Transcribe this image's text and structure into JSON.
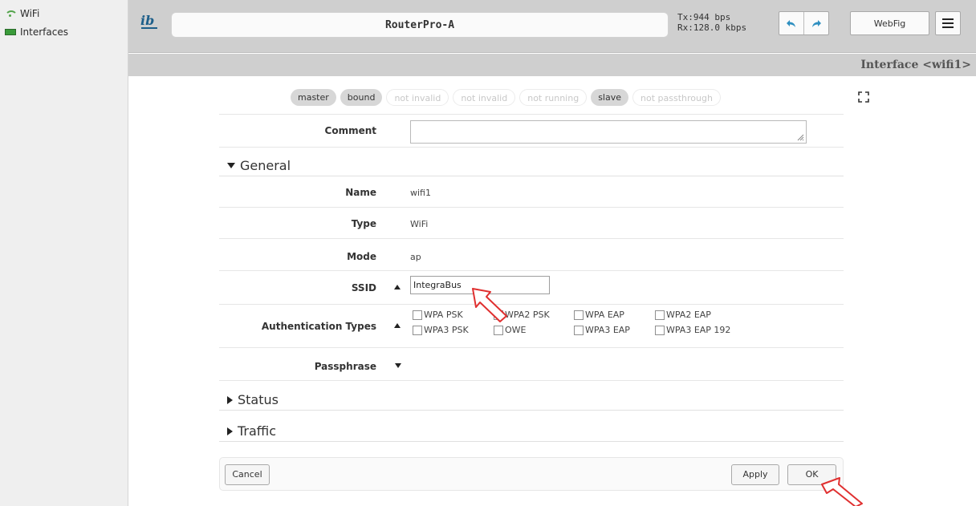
{
  "sidebar": {
    "items": [
      {
        "label": "WiFi",
        "icon": "wifi-icon"
      },
      {
        "label": "Interfaces",
        "icon": "interfaces-icon"
      }
    ]
  },
  "header": {
    "logo": "logo-icon",
    "device_name": "RouterPro-A",
    "tx": "Tx:944 bps",
    "rx": "Rx:128.0 kbps",
    "undo_icon": "undo-icon",
    "redo_icon": "redo-icon",
    "mode_label": "WebFig",
    "menu_icon": "hamburger-menu-icon"
  },
  "page": {
    "title": "Interface <wifi1>"
  },
  "flags": [
    {
      "label": "master",
      "active": true
    },
    {
      "label": "bound",
      "active": true
    },
    {
      "label": "not invalid",
      "active": false
    },
    {
      "label": "not invalid",
      "active": false
    },
    {
      "label": "not running",
      "active": false
    },
    {
      "label": "slave",
      "active": true
    },
    {
      "label": "not passthrough",
      "active": false
    }
  ],
  "form": {
    "comment_label": "Comment",
    "comment_value": "",
    "general": {
      "title": "General",
      "name_label": "Name",
      "name_value": "wifi1",
      "type_label": "Type",
      "type_value": "WiFi",
      "mode_label": "Mode",
      "mode_value": "ap",
      "ssid_label": "SSID",
      "ssid_value": "IntegraBus",
      "auth_label": "Authentication Types",
      "auth_options": [
        "WPA PSK",
        "WPA2 PSK",
        "WPA EAP",
        "WPA2 EAP",
        "WPA3 PSK",
        "OWE",
        "WPA3 EAP",
        "WPA3 EAP 192"
      ],
      "passphrase_label": "Passphrase"
    },
    "status_title": "Status",
    "traffic_title": "Traffic"
  },
  "footer": {
    "cancel": "Cancel",
    "apply": "Apply",
    "ok": "OK"
  },
  "colors": {
    "header_bg": "#cfcfcf",
    "accent_blue": "#2f8fc0",
    "annotation_red": "#e03030"
  }
}
